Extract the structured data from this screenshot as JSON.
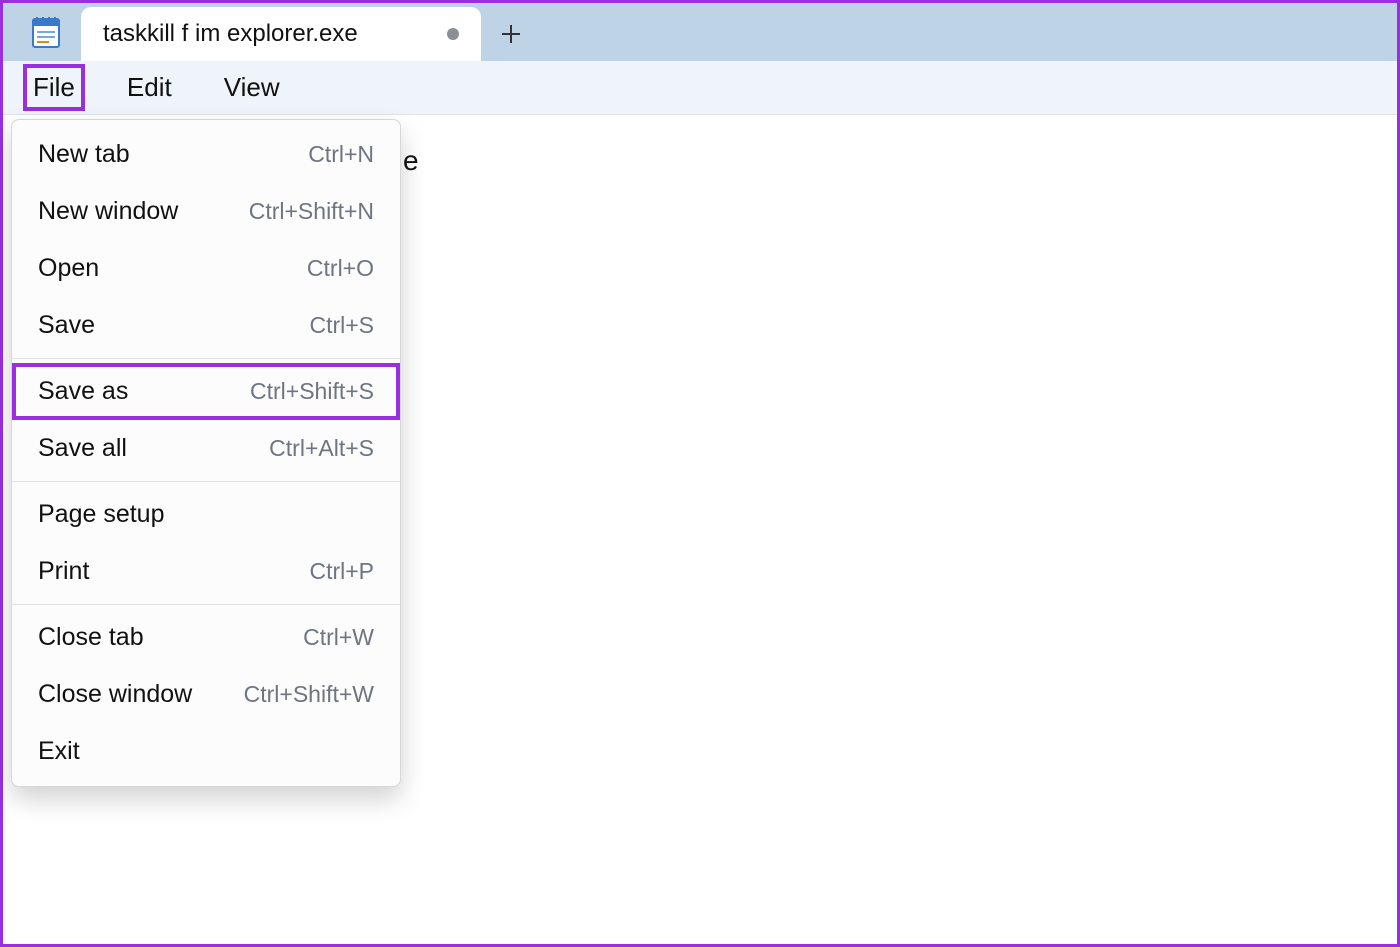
{
  "tab": {
    "title": "taskkill f im explorer.exe",
    "dirty": true
  },
  "menubar": {
    "file": "File",
    "edit": "Edit",
    "view": "View"
  },
  "editor": {
    "line1_visible_fragment": "e"
  },
  "file_menu": {
    "items": [
      {
        "label": "New tab",
        "shortcut": "Ctrl+N",
        "sep_after": false,
        "highlight": false
      },
      {
        "label": "New window",
        "shortcut": "Ctrl+Shift+N",
        "sep_after": false,
        "highlight": false
      },
      {
        "label": "Open",
        "shortcut": "Ctrl+O",
        "sep_after": false,
        "highlight": false
      },
      {
        "label": "Save",
        "shortcut": "Ctrl+S",
        "sep_after": true,
        "highlight": false
      },
      {
        "label": "Save as",
        "shortcut": "Ctrl+Shift+S",
        "sep_after": false,
        "highlight": true
      },
      {
        "label": "Save all",
        "shortcut": "Ctrl+Alt+S",
        "sep_after": true,
        "highlight": false
      },
      {
        "label": "Page setup",
        "shortcut": "",
        "sep_after": false,
        "highlight": false
      },
      {
        "label": "Print",
        "shortcut": "Ctrl+P",
        "sep_after": true,
        "highlight": false
      },
      {
        "label": "Close tab",
        "shortcut": "Ctrl+W",
        "sep_after": false,
        "highlight": false
      },
      {
        "label": "Close window",
        "shortcut": "Ctrl+Shift+W",
        "sep_after": false,
        "highlight": false
      },
      {
        "label": "Exit",
        "shortcut": "",
        "sep_after": false,
        "highlight": false
      }
    ]
  },
  "highlight_color": "#9a2fe0"
}
